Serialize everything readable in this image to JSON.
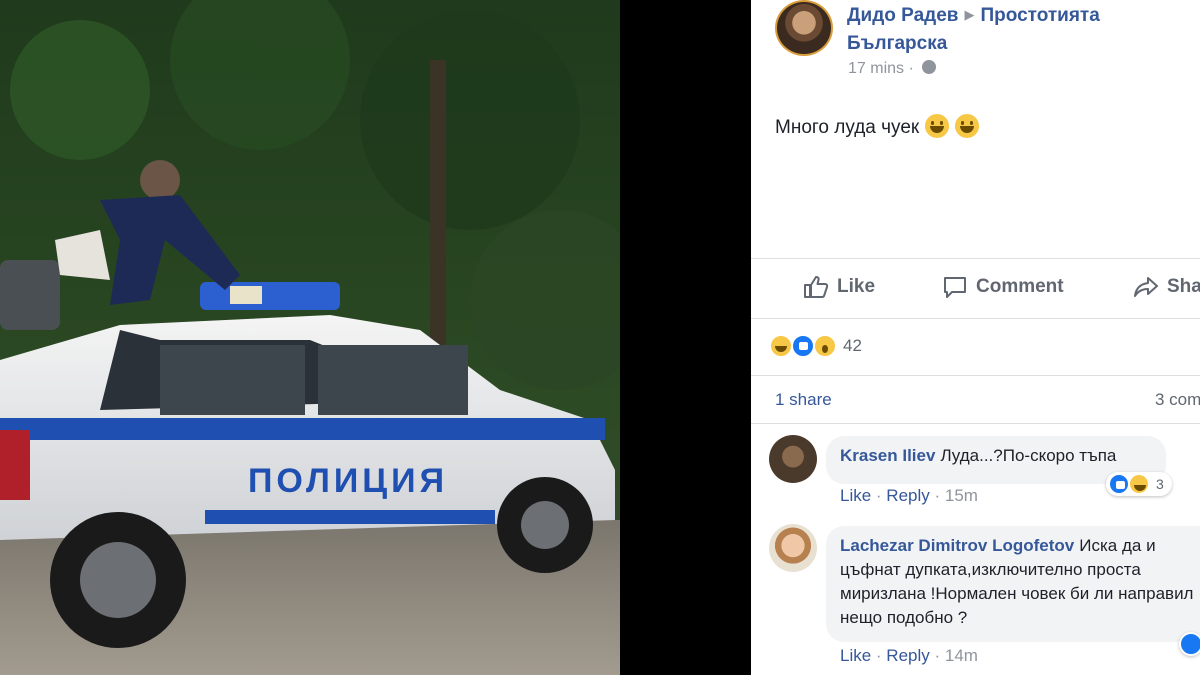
{
  "photo": {
    "car_text": "ПОЛИЦИЯ"
  },
  "post": {
    "author": "Дидо Радев",
    "group": "Простотията Българска",
    "time": "17 mins",
    "separator": "·",
    "text": "Много луда чуек",
    "emoji_count": 2
  },
  "actions": {
    "like": "Like",
    "comment": "Comment",
    "share": "Sha"
  },
  "reactions": {
    "types": [
      "haha",
      "like",
      "wow"
    ],
    "count": "42"
  },
  "stats": {
    "shares": "1 share",
    "comments": "3 com"
  },
  "comments": [
    {
      "name": "Krasen Iliev",
      "text": "Луда...?По-скоро тъпа",
      "like": "Like",
      "reply": "Reply",
      "time": "15m",
      "reaction_count": "3"
    },
    {
      "name": "Lachezar Dimitrov Logofetov",
      "text": "Иска да и цъфнат дупката,изключително проста миризлана !Нормален човек би ли направил нещо подобно ?",
      "like": "Like",
      "reply": "Reply",
      "time": "14m"
    }
  ],
  "colors": {
    "link": "#365899",
    "muted": "#90949c",
    "action": "#606770",
    "bubble": "#f2f3f5",
    "police_blue": "#1f4fb0"
  }
}
